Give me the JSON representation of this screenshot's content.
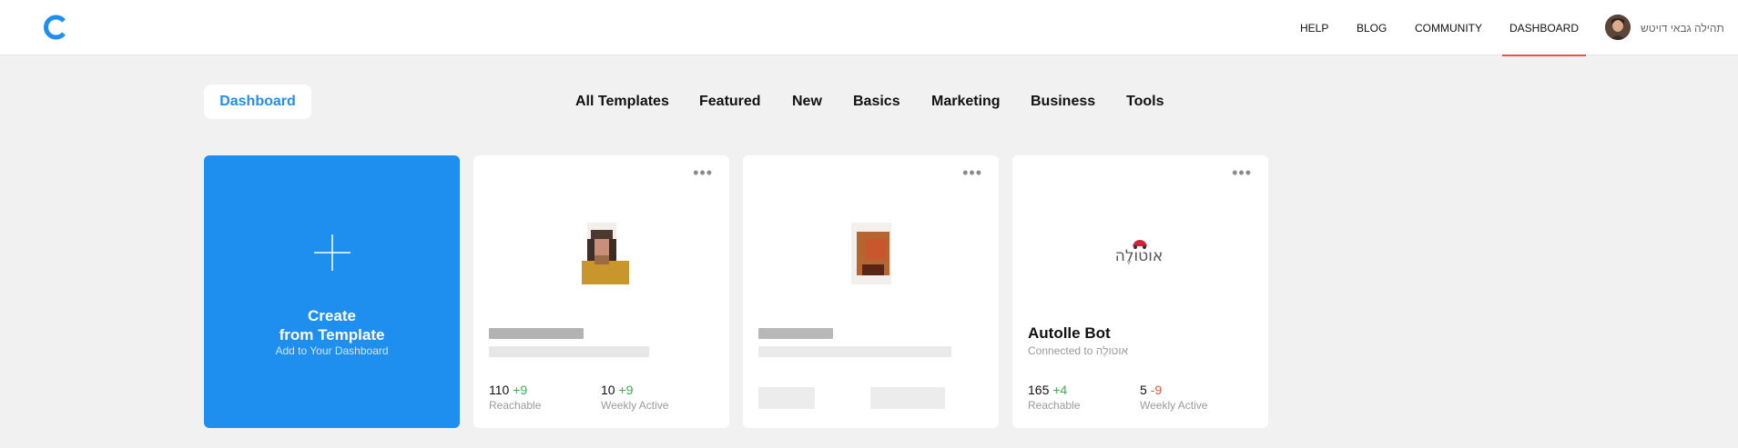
{
  "topbar": {
    "nav": [
      "HELP",
      "BLOG",
      "COMMUNITY",
      "DASHBOARD"
    ],
    "active_nav": "DASHBOARD",
    "user_name": "תהילה גבאי דויטש",
    "accent_color": "#1f8fef",
    "active_underline_color": "#e8543f"
  },
  "tabs": {
    "current": "Dashboard",
    "items": [
      "All Templates",
      "Featured",
      "New",
      "Basics",
      "Marketing",
      "Business",
      "Tools"
    ]
  },
  "cards": {
    "create": {
      "title_line1": "Create",
      "title_line2": "from Template",
      "subtitle": "Add to Your Dashboard",
      "icon": "plus-icon"
    },
    "bot1": {
      "reachable": "110",
      "reachable_delta": "+9",
      "reachable_label": "Reachable",
      "weekly": "10",
      "weekly_delta": "+9",
      "weekly_label": "Weekly Active",
      "more_icon": "more-dots-icon"
    },
    "bot2": {
      "more_icon": "more-dots-icon"
    },
    "bot3": {
      "logo_text": "אוטולֶה",
      "name": "Autolle Bot",
      "connected": "Connected to אוטולֶה",
      "reachable": "165",
      "reachable_delta": "+4",
      "reachable_label": "Reachable",
      "weekly": "5",
      "weekly_delta": "-9",
      "weekly_label": "Weekly Active",
      "more_icon": "more-dots-icon"
    }
  }
}
